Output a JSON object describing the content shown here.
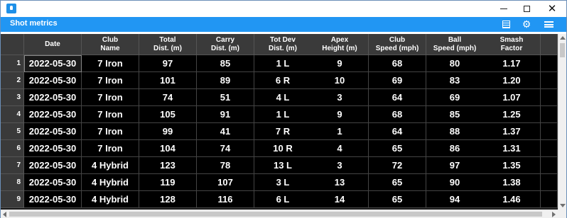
{
  "window": {
    "title": "",
    "controls": {
      "minimize": "minimize",
      "maximize": "maximize",
      "close": "✕"
    }
  },
  "toolbar": {
    "title": "Shot metrics",
    "icons": [
      "columns-icon",
      "gear-icon",
      "hamburger-menu-icon"
    ],
    "accent_color": "#2196f3"
  },
  "table": {
    "columns": [
      "Date",
      "Club\nName",
      "Total\nDist. (m)",
      "Carry\nDist. (m)",
      "Tot Dev\nDist. (m)",
      "Apex\nHeight (m)",
      "Club\nSpeed (mph)",
      "Ball\nSpeed (mph)",
      "Smash\nFactor"
    ],
    "row_numbers": [
      "1",
      "2",
      "3",
      "4",
      "5",
      "6",
      "7",
      "8",
      "9"
    ],
    "rows": [
      [
        "2022-05-30",
        "7 Iron",
        "97",
        "85",
        "1 L",
        "9",
        "68",
        "80",
        "1.17"
      ],
      [
        "2022-05-30",
        "7 Iron",
        "101",
        "89",
        "6 R",
        "10",
        "69",
        "83",
        "1.20"
      ],
      [
        "2022-05-30",
        "7 Iron",
        "74",
        "51",
        "4 L",
        "3",
        "64",
        "69",
        "1.07"
      ],
      [
        "2022-05-30",
        "7 Iron",
        "105",
        "91",
        "1 L",
        "9",
        "68",
        "85",
        "1.25"
      ],
      [
        "2022-05-30",
        "7 Iron",
        "99",
        "41",
        "7 R",
        "1",
        "64",
        "88",
        "1.37"
      ],
      [
        "2022-05-30",
        "7 Iron",
        "104",
        "74",
        "10 R",
        "4",
        "65",
        "86",
        "1.31"
      ],
      [
        "2022-05-30",
        "4 Hybrid",
        "123",
        "78",
        "13 L",
        "3",
        "72",
        "97",
        "1.35"
      ],
      [
        "2022-05-30",
        "4 Hybrid",
        "119",
        "107",
        "3 L",
        "13",
        "65",
        "90",
        "1.38"
      ],
      [
        "2022-05-30",
        "4 Hybrid",
        "128",
        "116",
        "6 L",
        "14",
        "65",
        "94",
        "1.46"
      ]
    ],
    "selected_cell": [
      0,
      0
    ]
  }
}
